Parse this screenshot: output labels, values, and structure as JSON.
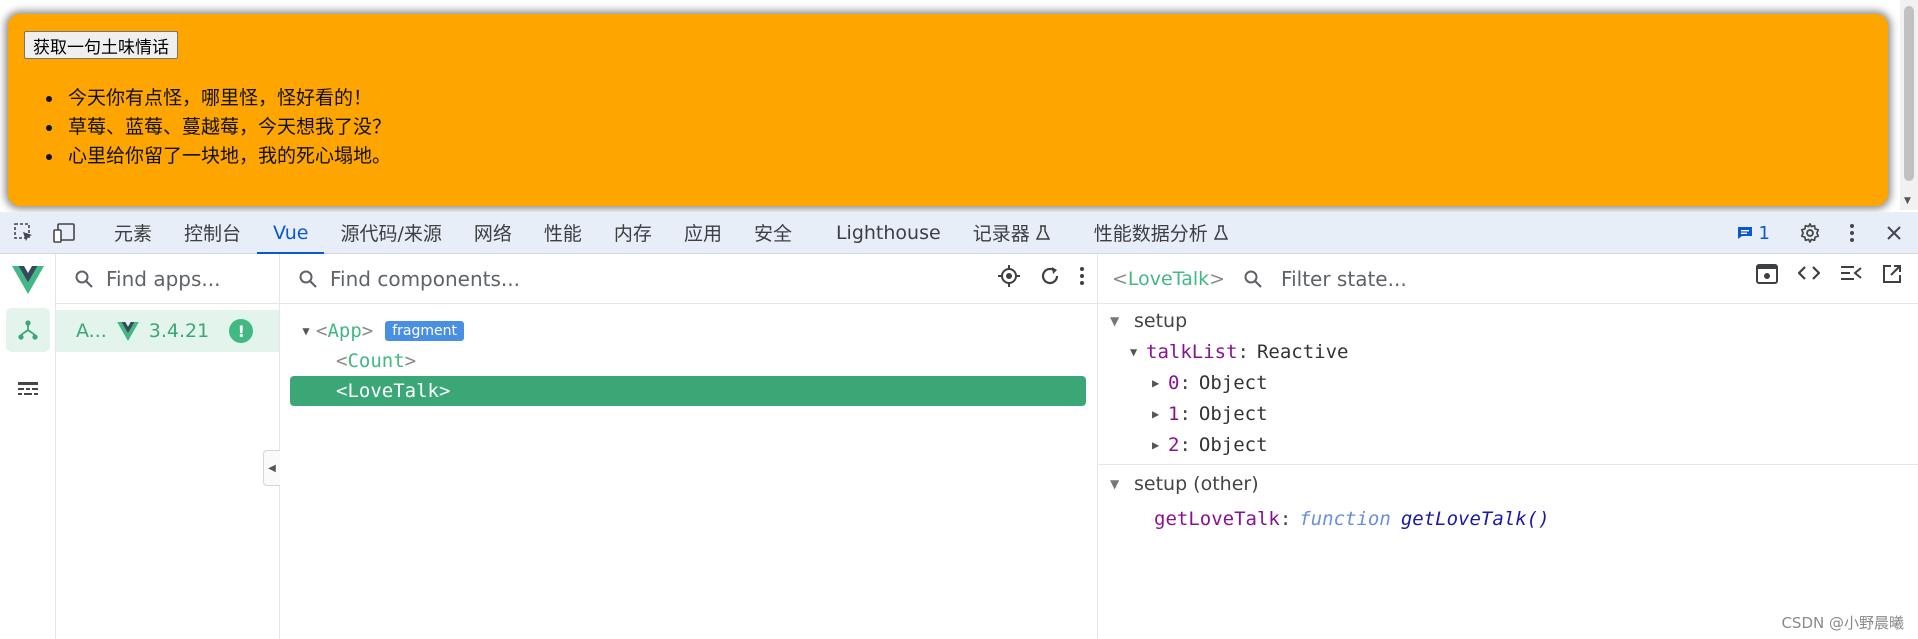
{
  "page": {
    "button_label": "获取一句土味情话",
    "talk_list": [
      "今天你有点怪，哪里怪，怪好看的！",
      "草莓、蓝莓、蔓越莓，今天想我了没？",
      "心里给你留了一块地，我的死心塌地。"
    ],
    "card_color": "#ffa500"
  },
  "devtools": {
    "tabs": [
      "元素",
      "控制台",
      "Vue",
      "源代码/来源",
      "网络",
      "性能",
      "内存",
      "应用",
      "安全",
      "Lighthouse",
      "记录器",
      "性能数据分析"
    ],
    "active_tab": "Vue",
    "message_count": "1"
  },
  "vue": {
    "apps_search_placeholder": "Find apps...",
    "app_item": {
      "name": "A...",
      "version": "3.4.21",
      "warn_symbol": "!"
    },
    "components_search_placeholder": "Find components...",
    "tree": [
      {
        "name": "App",
        "badge": "fragment",
        "expanded": true,
        "selected": false
      },
      {
        "name": "Count",
        "selected": false
      },
      {
        "name": "LoveTalk",
        "selected": true
      }
    ],
    "state": {
      "component_name": "LoveTalk",
      "filter_placeholder": "Filter state...",
      "sections": [
        {
          "title": "setup",
          "props": [
            {
              "key": "talkList",
              "value": "Reactive",
              "children": [
                {
                  "key": "0",
                  "value": "Object"
                },
                {
                  "key": "1",
                  "value": "Object"
                },
                {
                  "key": "2",
                  "value": "Object"
                }
              ]
            }
          ]
        },
        {
          "title": "setup (other)",
          "props": [
            {
              "key": "getLoveTalk",
              "fn_keyword": "function",
              "fn_name": "getLoveTalk()"
            }
          ]
        }
      ]
    },
    "accent_color": "#42b883"
  },
  "watermark": "CSDN @小野晨曦"
}
